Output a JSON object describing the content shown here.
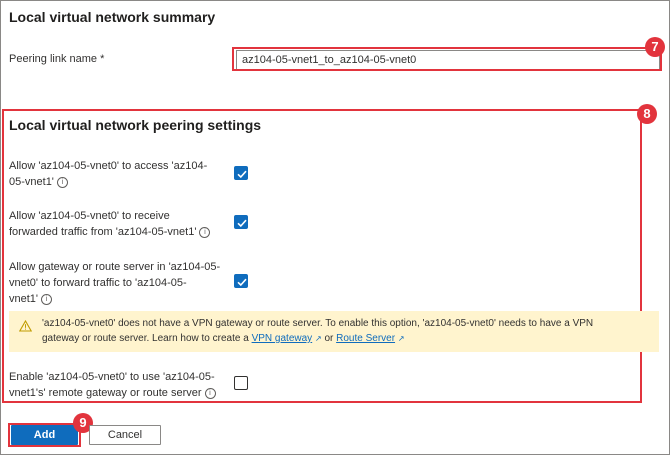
{
  "summary": {
    "title": "Local virtual network summary",
    "peering_link_label": "Peering link name *",
    "peering_link_value": "az104-05-vnet1_to_az104-05-vnet0"
  },
  "settings": {
    "title": "Local virtual network peering settings",
    "allow_access": {
      "label_line1": "Allow 'az104-05-vnet0' to access 'az104-",
      "label_line2": "05-vnet1'",
      "checked": true
    },
    "allow_forwarded": {
      "label_line1": "Allow 'az104-05-vnet0' to receive",
      "label_line2": "forwarded traffic from 'az104-05-vnet1'",
      "checked": true
    },
    "allow_gateway": {
      "label_line1": "Allow gateway or route server in 'az104-05-",
      "label_line2": "vnet0' to forward traffic to 'az104-05-",
      "label_line3": "vnet1'",
      "checked": true
    },
    "warning": {
      "text_line1": "'az104-05-vnet0' does not have a VPN gateway or route server. To enable this option, 'az104-05-vnet0' needs to have a VPN",
      "text_line2_prefix": "gateway or route server. Learn how to create a",
      "link1": "VPN gateway",
      "or_text": "or",
      "link2": "Route Server",
      "icon": "warning-icon"
    },
    "use_remote_gateway": {
      "label_line1": "Enable 'az104-05-vnet0' to use 'az104-05-",
      "label_line2": "vnet1's' remote gateway or route server",
      "checked": false
    }
  },
  "badges": {
    "b7": "7",
    "b8": "8",
    "b9": "9"
  },
  "buttons": {
    "add": "Add",
    "cancel": "Cancel"
  },
  "colors": {
    "accent": "#0f6cbd",
    "highlight": "#e2343d",
    "warning_bg": "#fff4ce"
  }
}
